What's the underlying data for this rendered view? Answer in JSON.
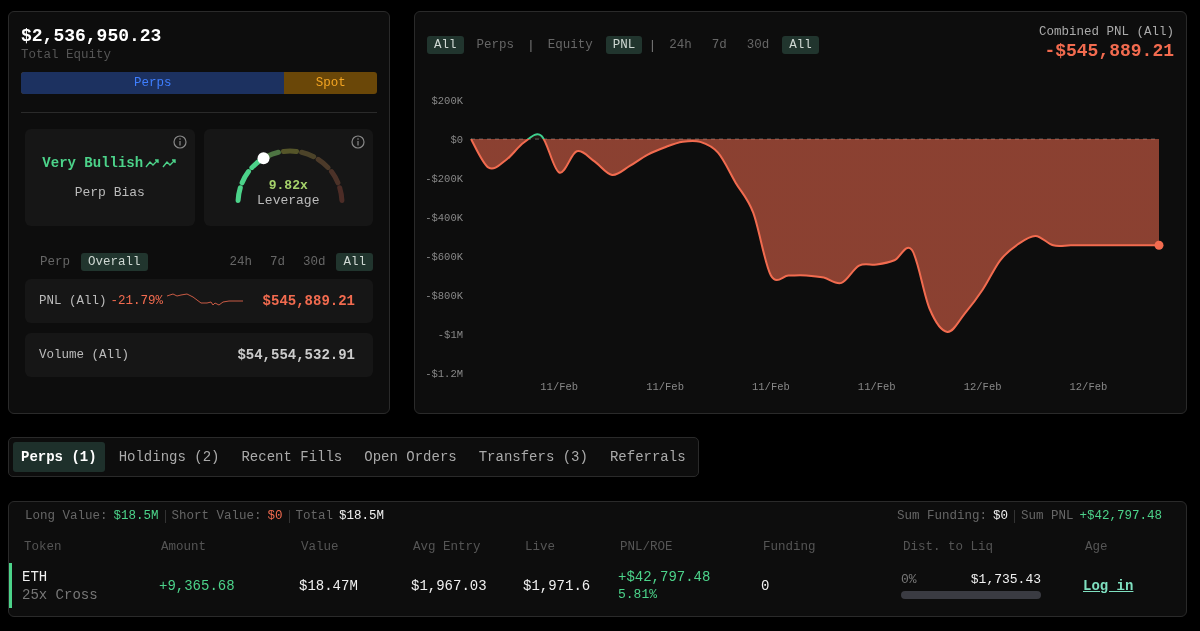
{
  "summary": {
    "total_equity": "$2,536,950.23",
    "label": "Total Equity"
  },
  "allocation_bar": {
    "level": 0.74,
    "perps_label": "Perps",
    "spot_label": "Spot"
  },
  "bias_card": {
    "value": "Very Bullish",
    "label": "Perp Bias"
  },
  "leverage_card": {
    "value": "9.82x",
    "label": "Leverage",
    "level": 0.33
  },
  "scope_filters": [
    {
      "label": "Perp",
      "selected": false
    },
    {
      "label": "Overall",
      "selected": true
    }
  ],
  "range_filters": [
    {
      "label": "24h",
      "selected": false
    },
    {
      "label": "7d",
      "selected": false
    },
    {
      "label": "30d",
      "selected": false
    },
    {
      "label": "All",
      "selected": true
    }
  ],
  "pnl_row": {
    "label": "PNL (All)",
    "change": "-21.79%",
    "value": "$545,889.21"
  },
  "volume_row": {
    "label": "Volume (All)",
    "value": "$54,554,532.91"
  },
  "chart_panel": {
    "filters": [
      {
        "kind": "toggle",
        "label": "All",
        "selected": true
      },
      {
        "kind": "toggle",
        "label": "Perps",
        "selected": false
      },
      {
        "kind": "separator",
        "label": "|"
      },
      {
        "kind": "toggle",
        "label": "Equity",
        "selected": false
      },
      {
        "kind": "toggle",
        "label": "PNL",
        "selected": true
      },
      {
        "kind": "separator",
        "label": "|"
      },
      {
        "kind": "toggle",
        "label": "24h",
        "selected": false
      },
      {
        "kind": "toggle",
        "label": "7d",
        "selected": false
      },
      {
        "kind": "toggle",
        "label": "30d",
        "selected": false
      },
      {
        "kind": "toggle",
        "label": "All",
        "selected": true
      }
    ],
    "title": "Combined PNL (All)",
    "value": "-$545,889.21",
    "chart_data": {
      "type": "area",
      "categories": [
        null,
        null,
        null,
        null,
        null,
        "11/Feb",
        null,
        null,
        null,
        null,
        null,
        "11/Feb",
        null,
        null,
        null,
        null,
        null,
        "11/Feb",
        null,
        null,
        null,
        null,
        null,
        "11/Feb",
        null,
        null,
        null,
        null,
        null,
        "12/Feb",
        null,
        null,
        null,
        null,
        null,
        "12/Feb",
        null,
        null,
        null,
        null
      ],
      "series": [
        {
          "color": "#f26b4f",
          "values": [
            0,
            -147000,
            -106000,
            -18000,
            16000,
            -172000,
            -63000,
            -115000,
            -184000,
            -138000,
            -81000,
            -42000,
            -14000,
            -15000,
            -70000,
            -224000,
            -379000,
            -700000,
            -700000,
            -700000,
            -711000,
            -738000,
            -649000,
            -644000,
            -622000,
            -569000,
            -872000,
            -989000,
            -894000,
            -773000,
            -622000,
            -540000,
            -497000,
            -545000,
            -545000,
            -545000,
            -545000,
            -545000,
            -545000,
            -545000
          ]
        }
      ],
      "ylim": [
        -1200000,
        200000
      ],
      "yticks": [
        {
          "value": 200000,
          "label": "$200K"
        },
        {
          "value": 0,
          "label": "$0"
        },
        {
          "value": -200000,
          "label": "-$200K"
        },
        {
          "value": -400000,
          "label": "-$400K"
        },
        {
          "value": -600000,
          "label": "-$600K"
        },
        {
          "value": -800000,
          "label": "-$800K"
        },
        {
          "value": -1000000,
          "label": "-$1M"
        },
        {
          "value": -1200000,
          "label": "-$1.2M"
        }
      ]
    }
  },
  "tabs": [
    {
      "label": "Perps (1)",
      "selected": true
    },
    {
      "label": "Holdings (2)",
      "selected": false
    },
    {
      "label": "Recent Fills",
      "selected": false
    },
    {
      "label": "Open Orders",
      "selected": false
    },
    {
      "label": "Transfers (3)",
      "selected": false
    },
    {
      "label": "Referrals",
      "selected": false
    }
  ],
  "positions": {
    "totals": [
      {
        "label": "Long Value:",
        "value": "$18.5M",
        "kind": "positive"
      },
      {
        "label": "Short Value:",
        "value": "$0",
        "kind": "negative"
      },
      {
        "label": "Total",
        "value": "$18.5M",
        "kind": "neutral"
      }
    ],
    "sums": [
      {
        "label": "Sum Funding:",
        "value": "$0",
        "kind": "neutral"
      },
      {
        "label": "Sum PNL",
        "value": "+$42,797.48",
        "kind": "positive"
      }
    ],
    "columns": [
      "Token",
      "Amount",
      "Value",
      "Avg Entry",
      "Live",
      "PNL/ROE",
      "Funding",
      "Dist. to Liq",
      "Age"
    ],
    "rows": [
      {
        "token": "ETH",
        "leverage": "25x Cross",
        "amount": "+9,365.68",
        "value": "$18.47M",
        "avg_entry": "$1,967.03",
        "live": "$1,971.6",
        "pnl": "+$42,797.48",
        "roe": "5.81%",
        "funding": "0",
        "liq_pct": "0%",
        "liq_price": "$1,735.43",
        "level": 0,
        "age": "Log in"
      }
    ]
  }
}
